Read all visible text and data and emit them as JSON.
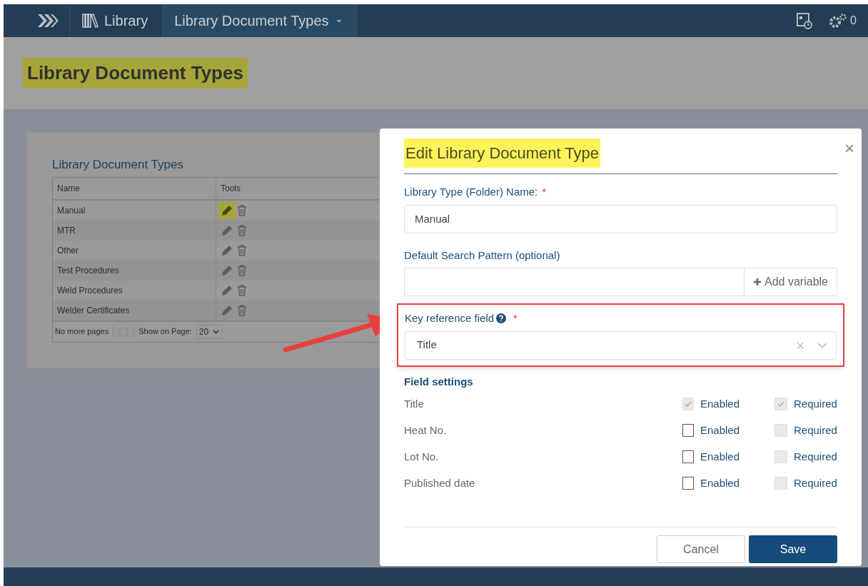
{
  "nav": {
    "breadcrumbs": [
      {
        "label": "Library",
        "kind": "library"
      },
      {
        "label": "Library Document Types",
        "kind": "dropdown",
        "caret": "⌄"
      }
    ],
    "badge_count": "0"
  },
  "page_title": "Library Document Types",
  "table": {
    "title": "Library Document Types",
    "columns": [
      "Name",
      "Tools"
    ],
    "rows": [
      {
        "name": "Manual",
        "selected": true
      },
      {
        "name": "MTR",
        "selected": false
      },
      {
        "name": "Other",
        "selected": false
      },
      {
        "name": "Test Procedures",
        "selected": false
      },
      {
        "name": "Weld Procedures",
        "selected": false
      },
      {
        "name": "Welder Certificates",
        "selected": false
      }
    ],
    "footer": {
      "status": "No more pages",
      "page_size_label": "Show on Page:",
      "page_size": "20"
    }
  },
  "dialog": {
    "title": "Edit Library Document Type",
    "close": "×",
    "name_label": "Library Type (Folder) Name:",
    "required_mark": "*",
    "name_value": "Manual",
    "pattern_label": "Default Search Pattern (optional)",
    "add_variable": "Add variable",
    "key_label": "Key reference field",
    "key_value": "Title",
    "clear": "×",
    "field_settings_title": "Field settings",
    "fields": [
      {
        "name": "Title",
        "enabled": {
          "label": "Enabled",
          "checked": true,
          "disabled": true
        },
        "required": {
          "label": "Required",
          "checked": true,
          "disabled": true
        }
      },
      {
        "name": "Heat No.",
        "enabled": {
          "label": "Enabled",
          "checked": false,
          "disabled": false
        },
        "required": {
          "label": "Required",
          "checked": false,
          "disabled": true
        }
      },
      {
        "name": "Lot No.",
        "enabled": {
          "label": "Enabled",
          "checked": false,
          "disabled": false
        },
        "required": {
          "label": "Required",
          "checked": false,
          "disabled": true
        }
      },
      {
        "name": "Published date",
        "enabled": {
          "label": "Enabled",
          "checked": false,
          "disabled": false
        },
        "required": {
          "label": "Required",
          "checked": false,
          "disabled": true
        }
      }
    ],
    "buttons": [
      {
        "label": "Cancel",
        "kind": "secondary"
      },
      {
        "label": "Save",
        "kind": "primary"
      }
    ]
  }
}
